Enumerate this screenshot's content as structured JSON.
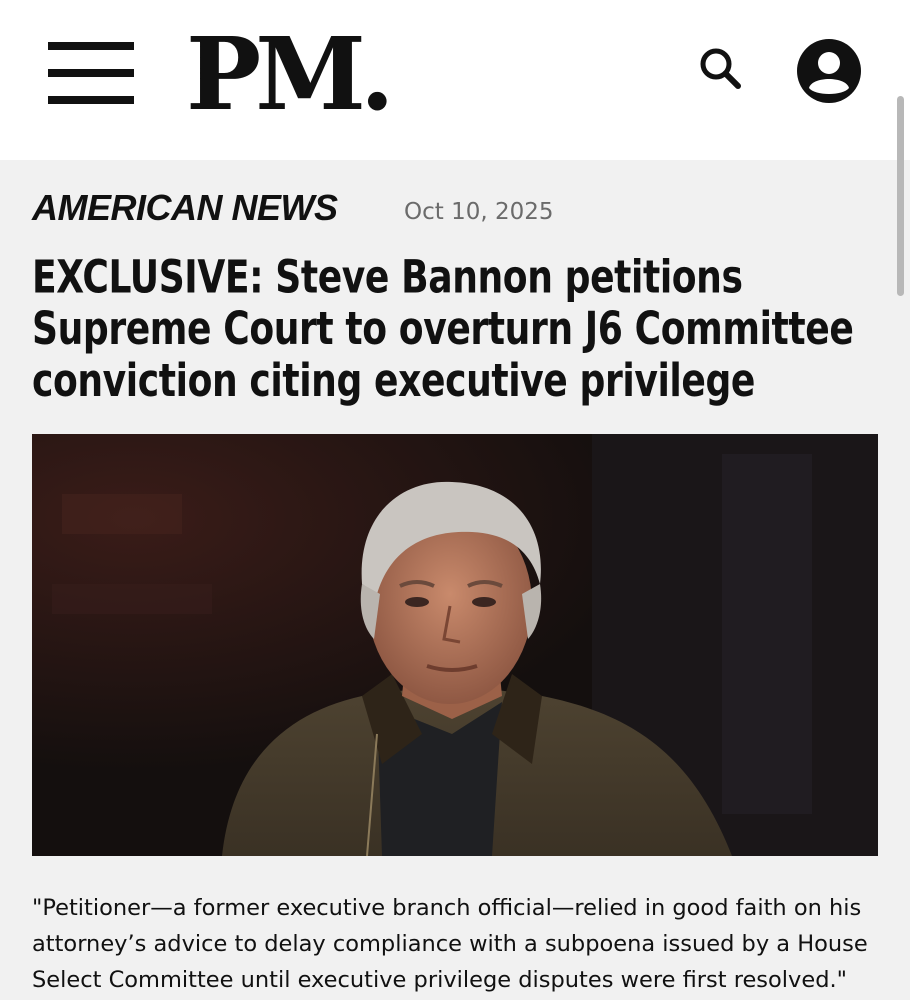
{
  "header": {
    "logo_text": "PM.",
    "menu_icon": "hamburger-menu-icon",
    "search_icon": "search-icon",
    "account_icon": "user-account-icon"
  },
  "article": {
    "category": "AMERICAN NEWS",
    "date": "Oct 10, 2025",
    "headline": "EXCLUSIVE: Steve Bannon petitions Supreme Court to overturn J6 Committee conviction citing executive privilege",
    "body_quote": "\"Petitioner—a former executive branch official—relied in good faith on his attorney’s advice to delay compliance with a subpoena issued by a House Select Committee until executive privilege disputes were first resolved.\""
  },
  "colors": {
    "header_bg": "#ffffff",
    "page_bg": "#f1f1f1",
    "text": "#111111",
    "date_gray": "#6b6b6b"
  }
}
